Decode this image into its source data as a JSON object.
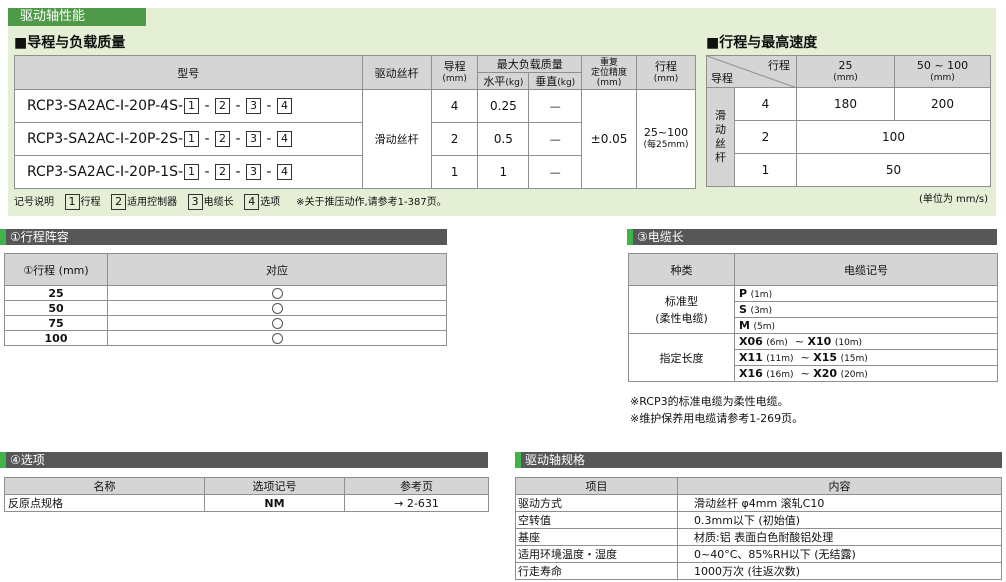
{
  "top_section": {
    "title": "驱动轴性能",
    "lead_load": {
      "title": "■导程与负载质量",
      "headers": {
        "model": "型号",
        "drive": "驱动丝杆",
        "lead": "导程",
        "lead_unit": "(mm)",
        "max_load": "最大负载质量",
        "horizontal": "水平",
        "vertical": "垂直",
        "load_unit": "(kg)",
        "repeat1": "重复",
        "repeat2": "定位精度",
        "repeat_unit": "(mm)",
        "stroke": "行程",
        "stroke_unit": "(mm)"
      },
      "rows": [
        {
          "model": "RCP3-SA2AC-I-20P-4S-",
          "lead": "4",
          "horizontal": "0.25",
          "vertical": "—"
        },
        {
          "model": "RCP3-SA2AC-I-20P-2S-",
          "lead": "2",
          "horizontal": "0.5",
          "vertical": "—"
        },
        {
          "model": "RCP3-SA2AC-I-20P-1S-",
          "lead": "1",
          "horizontal": "1",
          "vertical": "—"
        }
      ],
      "sep": "-",
      "box1": "1",
      "box2": "2",
      "box3": "3",
      "box4": "4",
      "drive_value": "滑动丝杆",
      "repeat_value": "±0.05",
      "stroke_value": "25~100",
      "stroke_note": "(每25mm)"
    },
    "legend": {
      "prefix": "记号说明",
      "b1": "1",
      "l1": "行程",
      "b2": "2",
      "l2": "适用控制器",
      "b3": "3",
      "l3": "电缆长",
      "b4": "4",
      "l4": "选项",
      "note": "※关于推压动作,请参考1-387页。"
    },
    "speed": {
      "title": "■行程与最高速度",
      "corner_top": "行程",
      "corner_bottom": "导程",
      "col1": "25",
      "col1_unit": "(mm)",
      "col2": "50 ~ 100",
      "col2_unit": "(mm)",
      "side_chars": [
        "滑",
        "动",
        "丝",
        "杆"
      ],
      "rows": [
        {
          "lead": "4",
          "v25": "180",
          "v50": "200"
        },
        {
          "lead": "2",
          "v": "100"
        },
        {
          "lead": "1",
          "v": "50"
        }
      ],
      "unit_note": "(单位为 mm/s)"
    }
  },
  "stroke_table": {
    "title": "①行程阵容",
    "col1": "①行程 (mm)",
    "col2": "对应",
    "rows": [
      "25",
      "50",
      "75",
      "100"
    ]
  },
  "cable_table": {
    "title": "③电缆长",
    "col1": "种类",
    "col2": "电缆记号",
    "standard_label1": "标准型",
    "standard_label2": "(柔性电缆)",
    "standard": [
      {
        "code": "P",
        "len": "(1m)"
      },
      {
        "code": "S",
        "len": "(3m)"
      },
      {
        "code": "M",
        "len": "(5m)"
      }
    ],
    "specified_label": "指定长度",
    "specified": [
      {
        "a": "X06",
        "alen": "(6m)",
        "b": "X10",
        "blen": "(10m)"
      },
      {
        "a": "X11",
        "alen": "(11m)",
        "b": "X15",
        "blen": "(15m)"
      },
      {
        "a": "X16",
        "alen": "(16m)",
        "b": "X20",
        "blen": "(20m)"
      }
    ],
    "tilde": "~",
    "note1": "※RCP3的标准电缆为柔性电缆。",
    "note2": "※维护保养用电缆请参考1-269页。"
  },
  "option_table": {
    "title": "④选项",
    "headers": [
      "名称",
      "选项记号",
      "参考页"
    ],
    "row": {
      "name": "反原点规格",
      "code": "NM",
      "page": "→ 2-631"
    }
  },
  "spec_table": {
    "title": "驱动轴规格",
    "headers": [
      "项目",
      "内容"
    ],
    "rows": [
      {
        "item": "驱动方式",
        "content": "滑动丝杆 φ4mm 滚轧C10"
      },
      {
        "item": "空转值",
        "content": "0.3mm以下 (初始值)"
      },
      {
        "item": "基座",
        "content": "材质:铝 表面白色耐酸铝处理"
      },
      {
        "item": "适用环境温度・湿度",
        "content": "0~40°C、85%RH以下 (无结露)"
      },
      {
        "item": "行走寿命",
        "content": "1000万次 (往返次数)"
      }
    ]
  }
}
